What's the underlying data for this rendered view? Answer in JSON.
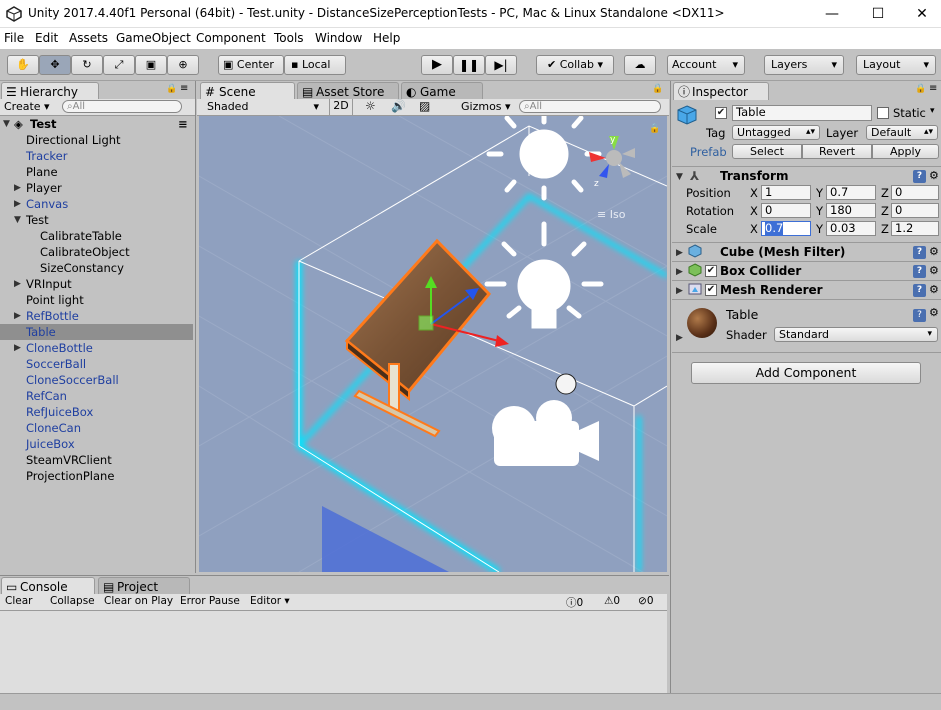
{
  "window": {
    "title": "Unity 2017.4.40f1 Personal (64bit) - Test.unity - DistanceSizePerceptionTests - PC, Mac & Linux Standalone <DX11>",
    "minimize": "—",
    "maximize": "☐",
    "close": "✕"
  },
  "menu": [
    "File",
    "Edit",
    "Assets",
    "GameObject",
    "Component",
    "Tools",
    "Window",
    "Help"
  ],
  "toolbar": {
    "pivot": "Center",
    "space": "Local",
    "collab": "Collab ▾",
    "account": "Account",
    "layers": "Layers",
    "layout": "Layout"
  },
  "hierarchy": {
    "tab": "Hierarchy",
    "create": "Create ▾",
    "search_placeholder": "All",
    "scene": "Test",
    "items": [
      {
        "label": "Directional Light",
        "color": "black"
      },
      {
        "label": "Tracker",
        "color": "blue"
      },
      {
        "label": "Plane",
        "color": "black"
      },
      {
        "label": "Player",
        "color": "black"
      },
      {
        "label": "Canvas",
        "color": "blue"
      },
      {
        "label": "Test",
        "color": "black"
      },
      {
        "label": "CalibrateTable",
        "color": "black"
      },
      {
        "label": "CalibrateObject",
        "color": "black"
      },
      {
        "label": "SizeConstancy",
        "color": "black"
      },
      {
        "label": "VRInput",
        "color": "black"
      },
      {
        "label": "Point light",
        "color": "black"
      },
      {
        "label": "RefBottle",
        "color": "blue"
      },
      {
        "label": "Table",
        "color": "blue"
      },
      {
        "label": "CloneBottle",
        "color": "blue"
      },
      {
        "label": "SoccerBall",
        "color": "blue"
      },
      {
        "label": "CloneSoccerBall",
        "color": "blue"
      },
      {
        "label": "RefCan",
        "color": "blue"
      },
      {
        "label": "RefJuiceBox",
        "color": "blue"
      },
      {
        "label": "CloneCan",
        "color": "blue"
      },
      {
        "label": "JuiceBox",
        "color": "blue"
      },
      {
        "label": "SteamVRClient",
        "color": "black"
      },
      {
        "label": "ProjectionPlane",
        "color": "black"
      }
    ]
  },
  "scene_tabs": {
    "scene": "Scene",
    "asset_store": "Asset Store",
    "game": "Game"
  },
  "scene_bar": {
    "shading": "Shaded",
    "mode2d": "2D",
    "gizmos": "Gizmos ▾",
    "search_placeholder": "All",
    "persp": "Iso"
  },
  "console": {
    "tab": "Console",
    "project_tab": "Project",
    "clear": "Clear",
    "collapse": "Collapse",
    "clear_on_play": "Clear on Play",
    "error_pause": "Error Pause",
    "editor": "Editor ▾",
    "info_count": "0",
    "warn_count": "0",
    "error_count": "0"
  },
  "inspector": {
    "tab": "Inspector",
    "object_name": "Table",
    "static_label": "Static",
    "tag_label": "Tag",
    "tag_value": "Untagged",
    "layer_label": "Layer",
    "layer_value": "Default",
    "prefab_label": "Prefab",
    "prefab_select": "Select",
    "prefab_revert": "Revert",
    "prefab_apply": "Apply",
    "transform": {
      "title": "Transform",
      "position_label": "Position",
      "rotation_label": "Rotation",
      "scale_label": "Scale",
      "position": {
        "x": "1",
        "y": "0.7",
        "z": "0"
      },
      "rotation": {
        "x": "0",
        "y": "180",
        "z": "0"
      },
      "scale": {
        "x": "0.7",
        "y": "0.03",
        "z": "1.2"
      }
    },
    "components": [
      {
        "title": "Cube (Mesh Filter)"
      },
      {
        "title": "Box Collider"
      },
      {
        "title": "Mesh Renderer"
      }
    ],
    "material_name": "Table",
    "shader_label": "Shader",
    "shader_value": "Standard",
    "add_component": "Add Component"
  },
  "colors": {
    "selection_outline": "#ff7a1a",
    "collider_glow": "#00e5ff",
    "scene_bg": "#8fa0bf"
  }
}
